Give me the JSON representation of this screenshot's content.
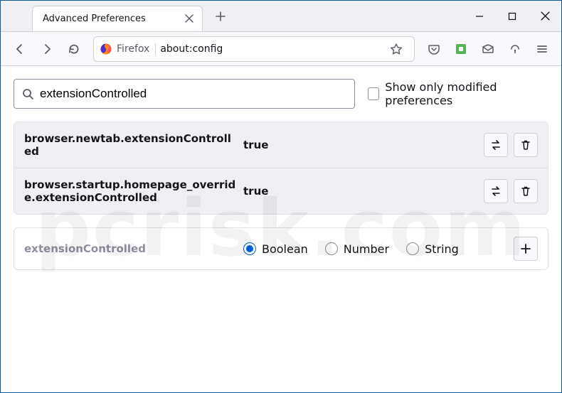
{
  "window": {
    "tab_title": "Advanced Preferences"
  },
  "addressbar": {
    "identity": "Firefox",
    "url": "about:config"
  },
  "config": {
    "search_value": "extensionControlled",
    "show_modified_label": "Show only modified preferences",
    "show_modified_checked": false,
    "prefs": [
      {
        "name": "browser.newtab.extensionControlled",
        "value": "true"
      },
      {
        "name": "browser.startup.homepage_override.extensionControlled",
        "value": "true"
      }
    ],
    "new_pref": {
      "name": "extensionControlled",
      "types": [
        "Boolean",
        "Number",
        "String"
      ],
      "selected": "Boolean"
    }
  },
  "watermark": "pcrisk.com"
}
